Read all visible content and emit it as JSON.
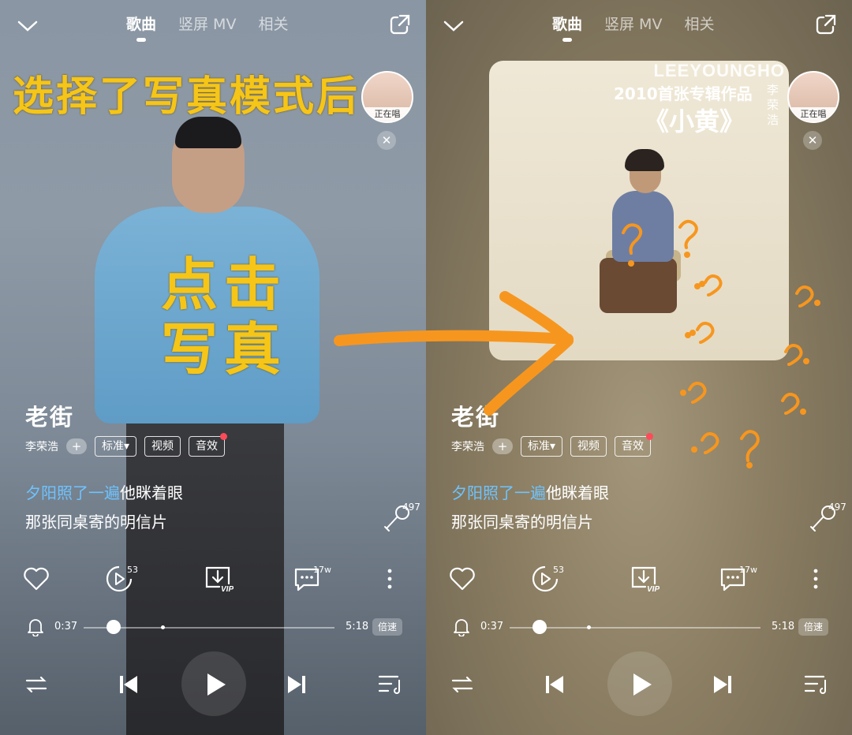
{
  "annotations": {
    "top_text": "选择了写真模式后",
    "click_line1": "点击",
    "click_line2": "写真"
  },
  "album": {
    "line1": "LEEYOUNGHO",
    "line2": "2010首张专辑作品",
    "line3": "《小黄》",
    "artist_vertical": "李荣浩"
  },
  "player": {
    "tabs": [
      "歌曲",
      "竖屏 MV",
      "相关"
    ],
    "active_tab": "歌曲",
    "singing_label": "正在唱",
    "song_title": "老街",
    "artist": "李荣浩",
    "quality_label": "标准▾",
    "video_label": "视频",
    "effect_label": "音效",
    "lyric_highlight": "夕阳照了一遍",
    "lyric_rest": "他眯着眼",
    "lyric_next": "那张同桌寄的明信片",
    "karaoke_count": "497",
    "comment_video_count": "53",
    "comment_count": "17w",
    "time_current": "0:37",
    "time_total": "5:18",
    "speed_label": "倍速",
    "progress_fraction": 0.12,
    "accent_color": "#6ec3ff",
    "annotation_color": "#f5c518"
  }
}
